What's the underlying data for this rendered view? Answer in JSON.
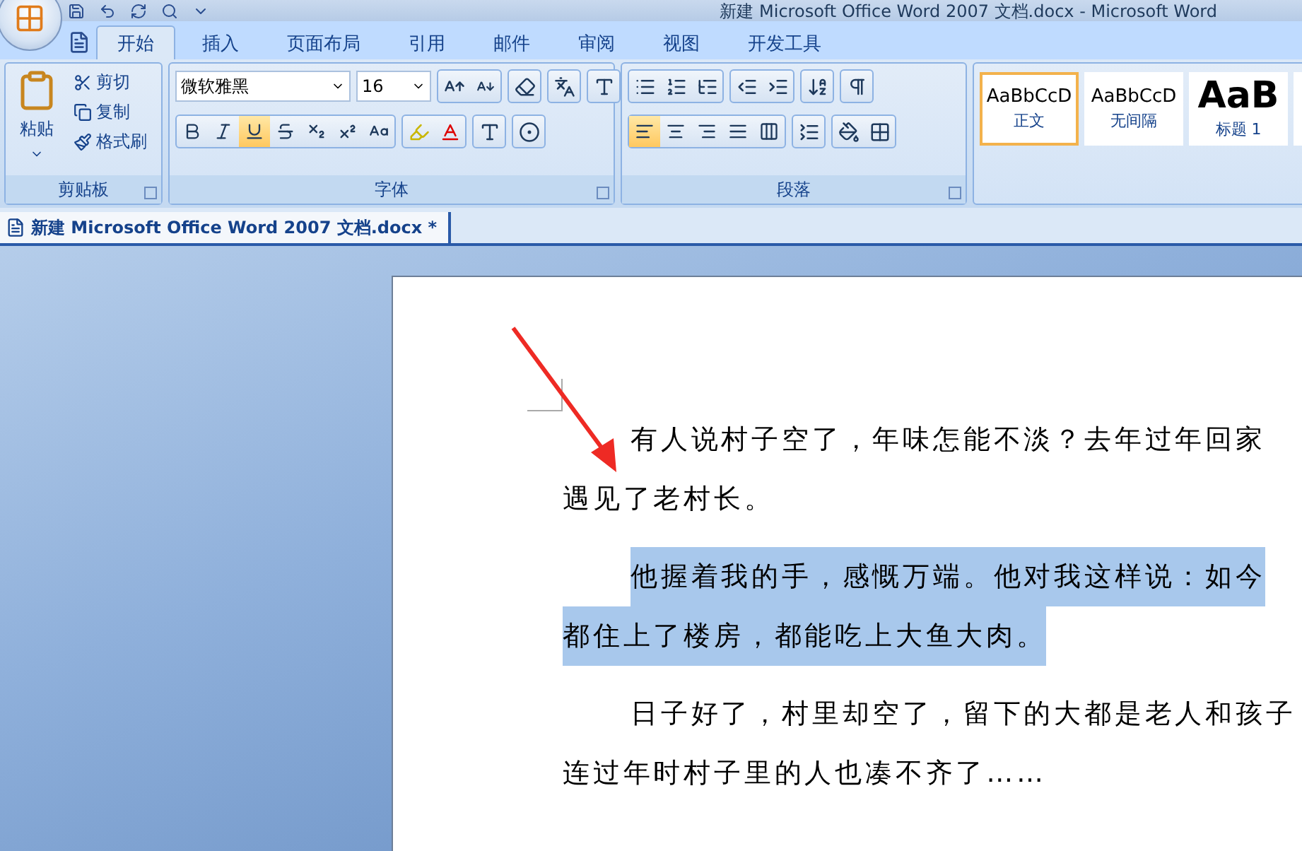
{
  "window": {
    "title": "新建 Microsoft Office Word 2007 文档.docx - Microsoft Word"
  },
  "ribbon_tabs": [
    {
      "label": "开始",
      "selected": true
    },
    {
      "label": "插入",
      "selected": false
    },
    {
      "label": "页面布局",
      "selected": false
    },
    {
      "label": "引用",
      "selected": false
    },
    {
      "label": "邮件",
      "selected": false
    },
    {
      "label": "审阅",
      "selected": false
    },
    {
      "label": "视图",
      "selected": false
    },
    {
      "label": "开发工具",
      "selected": false
    }
  ],
  "clipboard": {
    "paste": "粘贴",
    "items": [
      {
        "kind": "cut",
        "label": "剪切"
      },
      {
        "kind": "copy",
        "label": "复制"
      },
      {
        "kind": "painter",
        "label": "格式刷"
      }
    ],
    "label": "剪贴板"
  },
  "font": {
    "font_name": "微软雅黑",
    "font_size": "16",
    "label": "字体",
    "format_buttons": [
      {
        "kind": "bold",
        "selected": false
      },
      {
        "kind": "italic",
        "selected": false
      },
      {
        "kind": "underline",
        "selected": true
      },
      {
        "kind": "strike",
        "selected": false
      },
      {
        "kind": "subscript",
        "selected": false
      },
      {
        "kind": "superscript",
        "selected": false
      },
      {
        "kind": "case",
        "selected": false
      }
    ]
  },
  "paragraph": {
    "label": "段落",
    "alignment": [
      {
        "kind": "left",
        "selected": true
      },
      {
        "kind": "center",
        "selected": false
      },
      {
        "kind": "right",
        "selected": false
      },
      {
        "kind": "justify",
        "selected": false
      },
      {
        "kind": "distributed",
        "selected": false
      }
    ]
  },
  "styles": [
    {
      "preview": "AaBbCcD",
      "name": "正文",
      "kind": "normal",
      "selected": true
    },
    {
      "preview": "AaBbCcD",
      "name": "无间隔",
      "kind": "normal",
      "selected": false
    },
    {
      "preview": "AaB",
      "name": "标题 1",
      "kind": "heading",
      "selected": false
    }
  ],
  "document_tab": {
    "title": "新建 Microsoft Office Word 2007 文档.docx *"
  },
  "paragraphs": [
    {
      "selected": false,
      "lines": [
        "有人说村子空了，年味怎能不淡？去年过年回家",
        "遇见了老村长。"
      ]
    },
    {
      "selected": true,
      "lines": [
        "他握着我的手，感慨万端。他对我这样说：如今",
        "都住上了楼房，都能吃上大鱼大肉。"
      ]
    },
    {
      "selected": false,
      "lines": [
        "日子好了，村里却空了，留下的大都是老人和孩子",
        "连过年时村子里的人也凑不齐了……"
      ]
    }
  ]
}
